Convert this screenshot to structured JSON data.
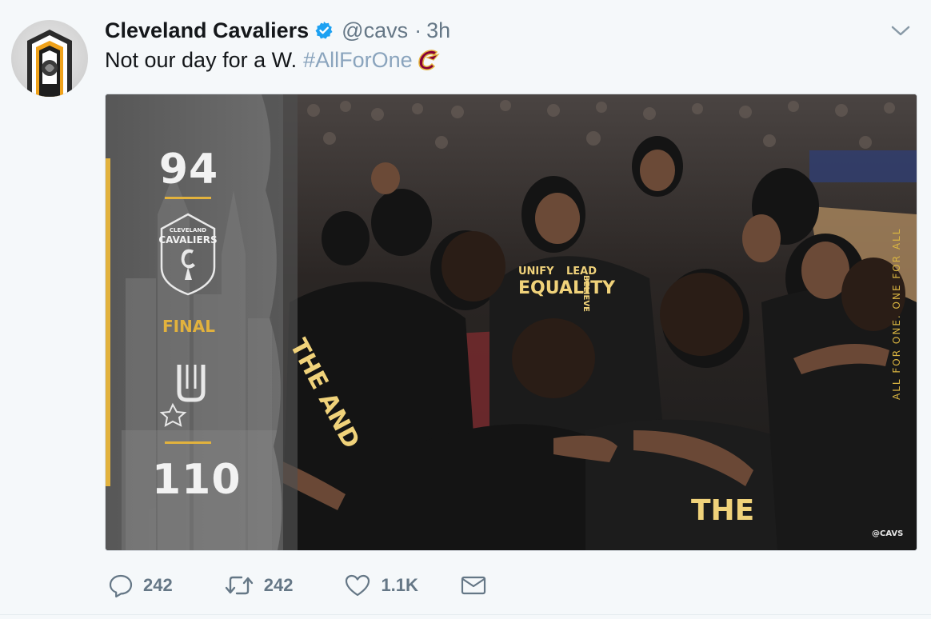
{
  "tweet": {
    "author_name": "Cleveland Cavaliers",
    "handle": "@cavs",
    "separator": "·",
    "time": "3h",
    "text": "Not our day for a W.",
    "hashtag": "#AllForOne"
  },
  "media": {
    "cavs_score": "94",
    "final_label": "FINAL",
    "spurs_score": "110",
    "badge_line1": "CLEVELAND",
    "badge_line2": "CAVALIERS",
    "jersey_left": "THE AND",
    "jersey_bottom": "THE",
    "shirt_text1": "UNIFY",
    "shirt_text2": "LEAD",
    "shirt_text3": "EQUALITY",
    "shirt_text4": "BELIEVE",
    "vertical_tag": "ALL FOR ONE. ONE FOR ALL",
    "watermark": "@CAVS",
    "colors": {
      "cavs_gold": "#e2b23d",
      "cavs_wine": "#860038"
    }
  },
  "actions": {
    "replies": "242",
    "retweets": "242",
    "likes": "1.1K"
  },
  "icons": {
    "reply": "reply-icon",
    "retweet": "retweet-icon",
    "like": "heart-icon",
    "dm": "envelope-icon",
    "caret": "chevron-down-icon",
    "verified": "verified-badge-icon"
  }
}
